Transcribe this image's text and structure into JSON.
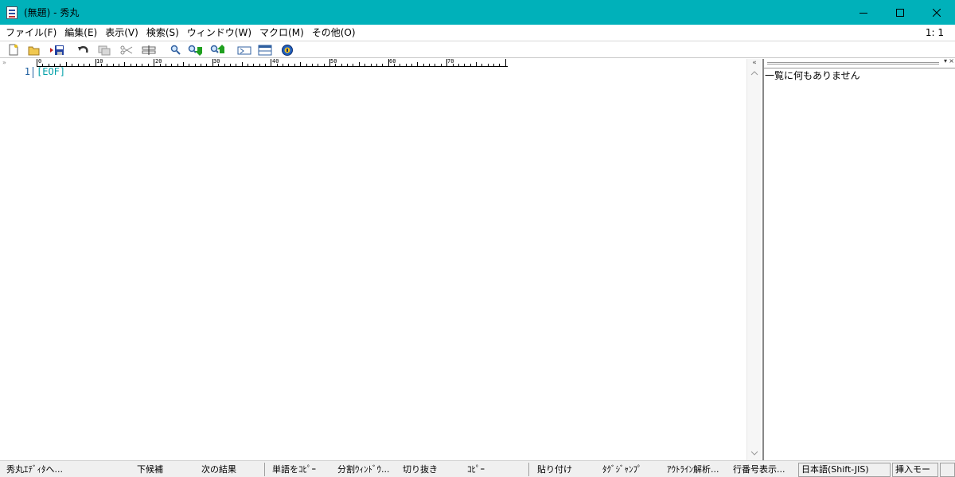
{
  "window": {
    "title": "(無題) - 秀丸"
  },
  "menu": {
    "items": [
      {
        "label": "ファイル(F)"
      },
      {
        "label": "編集(E)"
      },
      {
        "label": "表示(V)"
      },
      {
        "label": "検索(S)"
      },
      {
        "label": "ウィンドウ(W)"
      },
      {
        "label": "マクロ(M)"
      },
      {
        "label": "その他(O)"
      }
    ],
    "cursor_position": "1: 1"
  },
  "toolbar": {
    "buttons": [
      {
        "icon": "new-file-icon"
      },
      {
        "icon": "open-folder-icon"
      },
      {
        "icon": "save-as-icon"
      },
      {
        "icon": "undo-icon"
      },
      {
        "icon": "copy-icon"
      },
      {
        "icon": "cut-icon"
      },
      {
        "icon": "paste-icon"
      },
      {
        "icon": "search-icon"
      },
      {
        "icon": "search-down-icon"
      },
      {
        "icon": "search-up-icon"
      },
      {
        "icon": "tag-jump-icon"
      },
      {
        "icon": "split-window-icon"
      },
      {
        "icon": "help-icon"
      }
    ]
  },
  "editor": {
    "ruler_labels": [
      "0",
      "10",
      "20",
      "30",
      "40",
      "50",
      "60",
      "70"
    ],
    "line_number": "1",
    "eof_marker": "[EOF]",
    "left_marker": "»"
  },
  "right_pane": {
    "collapse_button": "«",
    "message": "一覧に何もありません"
  },
  "statusbar": {
    "items": [
      "秀丸ｴﾃﾞｨﾀへ...",
      "下候補",
      "次の結果",
      "単語をｺﾋﾟｰ",
      "分割ｳｨﾝﾄﾞｳ...",
      "切り抜き",
      "ｺﾋﾟｰ",
      "貼り付け",
      "ﾀｸﾞｼﾞｬﾝﾌﾟ",
      "ｱｳﾄﾗｲﾝ解析...",
      "行番号表示..."
    ],
    "encoding": "日本語(Shift-JIS)",
    "mode": "挿入モード"
  },
  "colors": {
    "titlebar": "#00b1ba",
    "eof": "#00a0a8",
    "line_number": "#2060a0"
  }
}
